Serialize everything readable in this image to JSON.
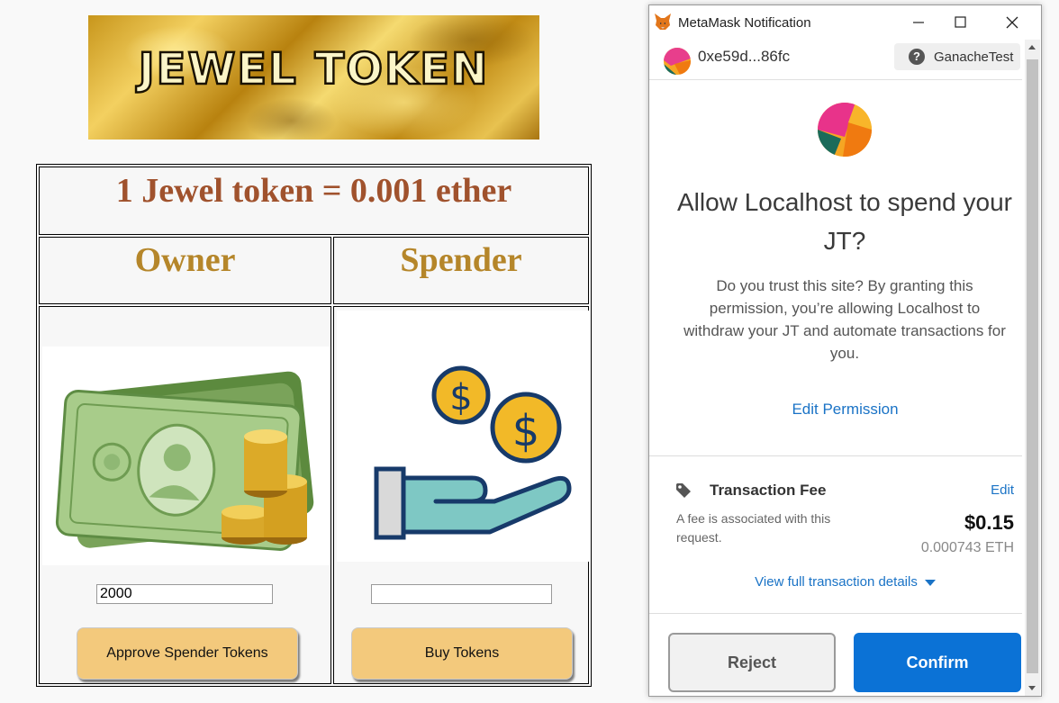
{
  "dapp": {
    "banner_text": "JEWEL TOKEN",
    "rate": "1 Jewel token = 0.001 ether",
    "owner": {
      "heading": "Owner",
      "amount_value": "2000",
      "button_label": "Approve Spender Tokens"
    },
    "spender": {
      "heading": "Spender",
      "amount_value": "",
      "button_label": "Buy Tokens"
    }
  },
  "metamask": {
    "window_title": "MetaMask Notification",
    "account_address": "0xe59d...86fc",
    "network_name": "GanacheTest",
    "heading": "Allow Localhost to spend your JT?",
    "description": "Do you trust this site? By granting this permission, you’re allowing Localhost to withdraw your JT and automate transactions for you.",
    "edit_permission_label": "Edit Permission",
    "fee": {
      "label": "Transaction Fee",
      "edit_label": "Edit",
      "description": "A fee is associated with this request.",
      "usd": "$0.15",
      "eth": "0.000743 ETH"
    },
    "view_details_label": "View full transaction details",
    "reject_label": "Reject",
    "confirm_label": "Confirm"
  },
  "colors": {
    "brand_blue": "#0b72d6",
    "link_blue": "#1a73c6",
    "action_button": "#f3c97c",
    "rate_text": "#a0522d",
    "role_text": "#b5862a"
  }
}
